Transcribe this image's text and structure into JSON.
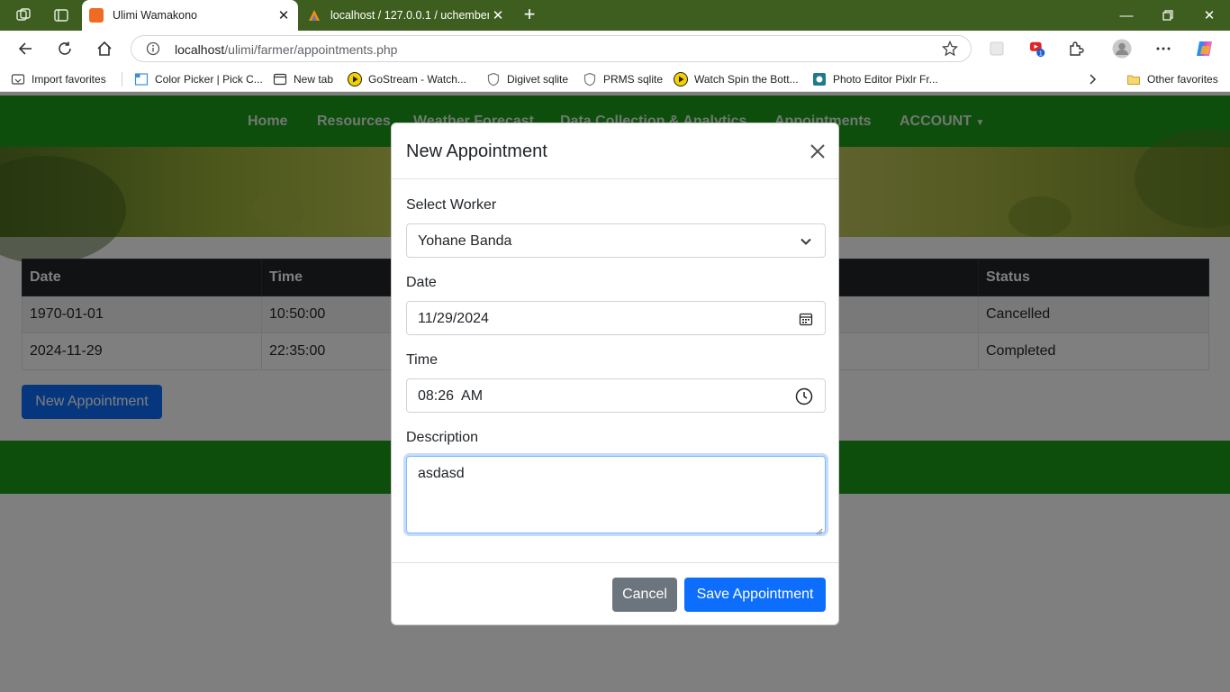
{
  "browser": {
    "tabs": [
      {
        "title": "Ulimi Wamakono",
        "active": true
      },
      {
        "title": "localhost / 127.0.0.1 / uchembere",
        "active": false
      }
    ],
    "url_host": "localhost",
    "url_path": "/ulimi/farmer/appointments.php",
    "extension_badge": "1",
    "favorites": [
      {
        "label": "Import favorites",
        "icon": "import-icon"
      },
      {
        "label": "Color Picker | Pick C...",
        "icon": "color-picker-icon"
      },
      {
        "label": "New tab",
        "icon": "newtab-icon"
      },
      {
        "label": "GoStream - Watch...",
        "icon": "play-icon"
      },
      {
        "label": "Digivet sqlite",
        "icon": "shield-icon"
      },
      {
        "label": "PRMS sqlite",
        "icon": "shield-icon"
      },
      {
        "label": "Watch Spin the Bott...",
        "icon": "play-icon"
      },
      {
        "label": "Photo Editor Pixlr Fr...",
        "icon": "pixlr-icon"
      }
    ],
    "other_favorites": "Other favorites",
    "colors": {
      "tabbar": "#3d5e1f"
    }
  },
  "site": {
    "nav": [
      "Home",
      "Resources",
      "Weather Forecast",
      "Data Collection & Analytics",
      "Appointments",
      "ACCOUNT"
    ],
    "colors": {
      "nav": "#1a9c1a",
      "primary": "#0d6efd"
    }
  },
  "table": {
    "headers": [
      "Date",
      "Time",
      "",
      "",
      "Status"
    ],
    "rows": [
      [
        "1970-01-01",
        "10:50:00",
        "",
        "",
        "Cancelled"
      ],
      [
        "2024-11-29",
        "22:35:00",
        "",
        "",
        "Completed"
      ]
    ]
  },
  "new_appointment_button": "New Appointment",
  "modal": {
    "title": "New Appointment",
    "worker_label": "Select Worker",
    "worker_value": "Yohane Banda",
    "date_label": "Date",
    "date_value": "11/29/2024",
    "time_label": "Time",
    "time_value": "08:26  AM",
    "description_label": "Description",
    "description_value": "asdasd",
    "cancel_label": "Cancel",
    "save_label": "Save Appointment"
  }
}
